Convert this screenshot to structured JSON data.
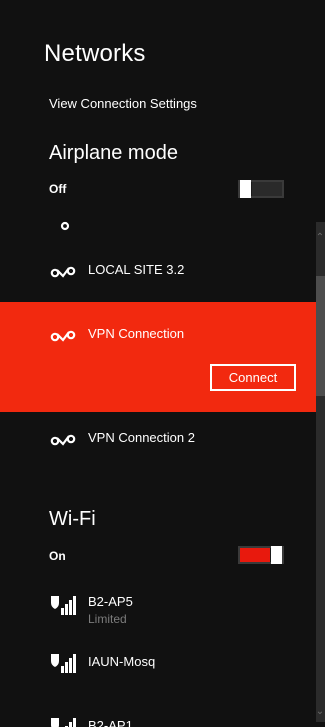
{
  "panel": {
    "title": "Networks",
    "view_settings_link": "View Connection Settings"
  },
  "airplane": {
    "section_title": "Airplane mode",
    "state_label": "Off",
    "enabled": false
  },
  "vpn_list": [
    {
      "label": "LOCAL SITE 3.2",
      "icon": "vpn-icon"
    },
    {
      "label": "VPN Connection",
      "icon": "vpn-icon",
      "selected": true
    },
    {
      "label": "VPN Connection 2",
      "icon": "vpn-icon"
    }
  ],
  "connect_button_label": "Connect",
  "wifi": {
    "section_title": "Wi-Fi",
    "state_label": "On",
    "enabled": true,
    "networks": [
      {
        "ssid": "B2-AP5",
        "status": "Limited",
        "icon": "wifi-signal-shield-icon"
      },
      {
        "ssid": "IAUN-Mosq",
        "status": "",
        "icon": "wifi-signal-shield-icon"
      },
      {
        "ssid": "B2-AP1",
        "status": "",
        "icon": "wifi-signal-shield-icon"
      }
    ]
  },
  "colors": {
    "background": "#111111",
    "accent": "#f2290f",
    "toggle_on": "#e8190d",
    "muted_text": "#7c7c7c"
  }
}
